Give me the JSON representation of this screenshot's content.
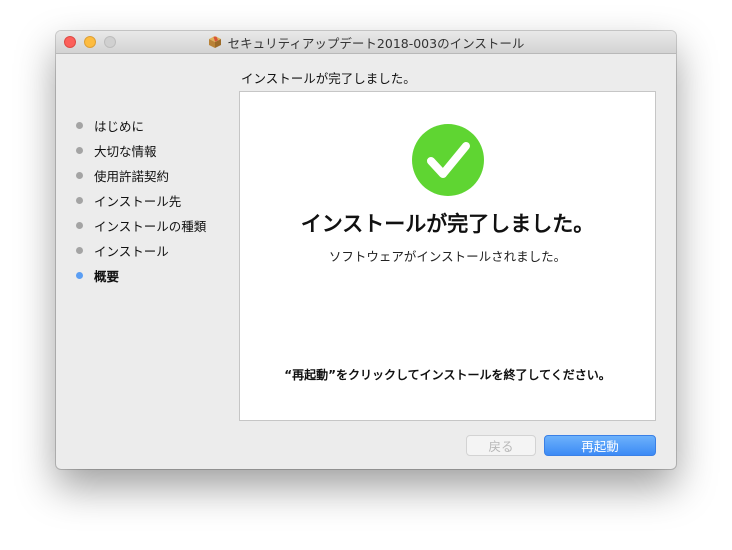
{
  "window": {
    "title": "セキュリティアップデート2018-003のインストール"
  },
  "header": {
    "status": "インストールが完了しました。"
  },
  "sidebar": {
    "steps": [
      {
        "label": "はじめに"
      },
      {
        "label": "大切な情報"
      },
      {
        "label": "使用許諾契約"
      },
      {
        "label": "インストール先"
      },
      {
        "label": "インストールの種類"
      },
      {
        "label": "インストール"
      },
      {
        "label": "概要"
      }
    ],
    "current_step": "概要"
  },
  "main": {
    "icon": "checkmark-icon",
    "title": "インストールが完了しました。",
    "subtitle": "ソフトウェアがインストールされました。",
    "note": "“再起動”をクリックしてインストールを終了してください。"
  },
  "buttons": {
    "back_label": "戻る",
    "restart_label": "再起動"
  },
  "colors": {
    "success_green": "#5fd532",
    "accent_blue": "#3c8af5",
    "current_step_dot": "#5b9ef3",
    "inactive_dot": "#a4a4a4",
    "close": "#fc605b",
    "minimize": "#fdbc40"
  }
}
